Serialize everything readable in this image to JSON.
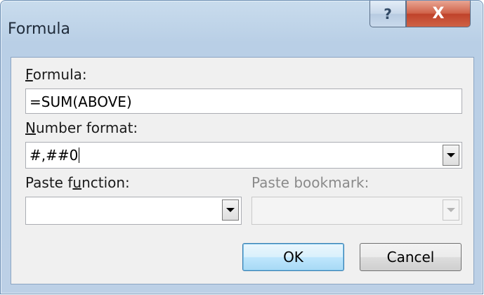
{
  "dialog": {
    "title": "Formula",
    "help_glyph": "?",
    "close_glyph": "X"
  },
  "formula": {
    "label_first": "F",
    "label_rest": "ormula:",
    "value": "=SUM(ABOVE)"
  },
  "number_format": {
    "label_first": "N",
    "label_rest": "umber format:",
    "value": "#,##0"
  },
  "paste_function": {
    "label_pre": "Paste f",
    "label_ul": "u",
    "label_post": "nction:",
    "value": ""
  },
  "paste_bookmark": {
    "label": "Paste bookmark:",
    "value": "",
    "disabled": true
  },
  "buttons": {
    "ok": "OK",
    "cancel": "Cancel"
  }
}
